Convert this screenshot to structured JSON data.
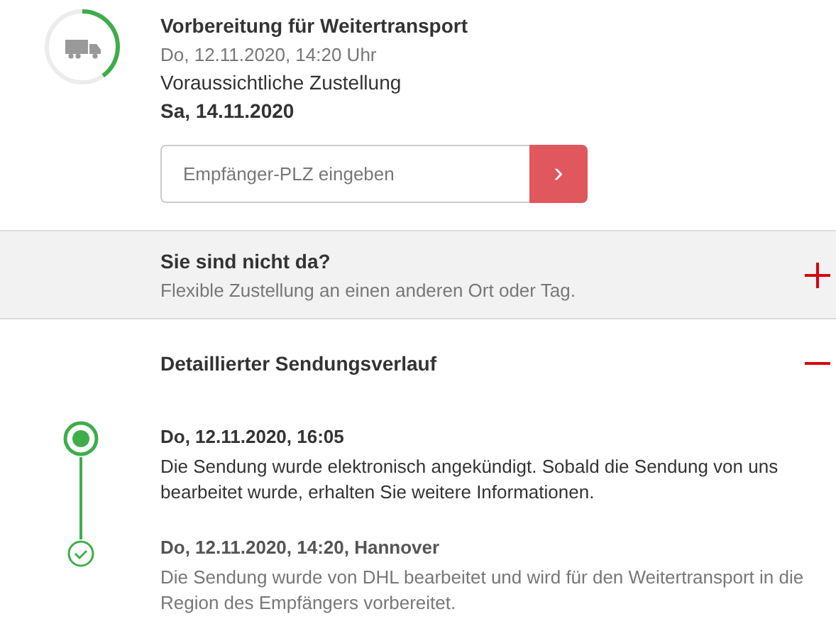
{
  "status": {
    "title": "Vorbereitung für Weitertransport",
    "timestamp": "Do, 12.11.2020, 14:20 Uhr",
    "delivery_label": "Voraussichtliche Zustellung",
    "delivery_date": "Sa, 14.11.2020"
  },
  "zip_field": {
    "placeholder": "Empfänger-PLZ eingeben",
    "button": "›"
  },
  "sections": [
    {
      "title": "Sie sind nicht da?",
      "subtitle": "Flexible Zustellung an einen anderen Ort oder Tag.",
      "expanded": false
    },
    {
      "title": "Detaillierter Sendungsverlauf",
      "expanded": true
    }
  ],
  "events": [
    {
      "kind": "current",
      "time": "Do, 12.11.2020, 16:05",
      "text": "Die Sendung wurde elektronisch angekündigt. Sobald die Sendung von uns bearbeitet wurde, erhalten Sie weitere Informationen."
    },
    {
      "kind": "done",
      "time": "Do, 12.11.2020, 14:20, Hannover",
      "text": "Die Sendung wurde von DHL bearbeitet und wird für den Weitertransport in die Region des Empfängers vorbereitet."
    }
  ]
}
